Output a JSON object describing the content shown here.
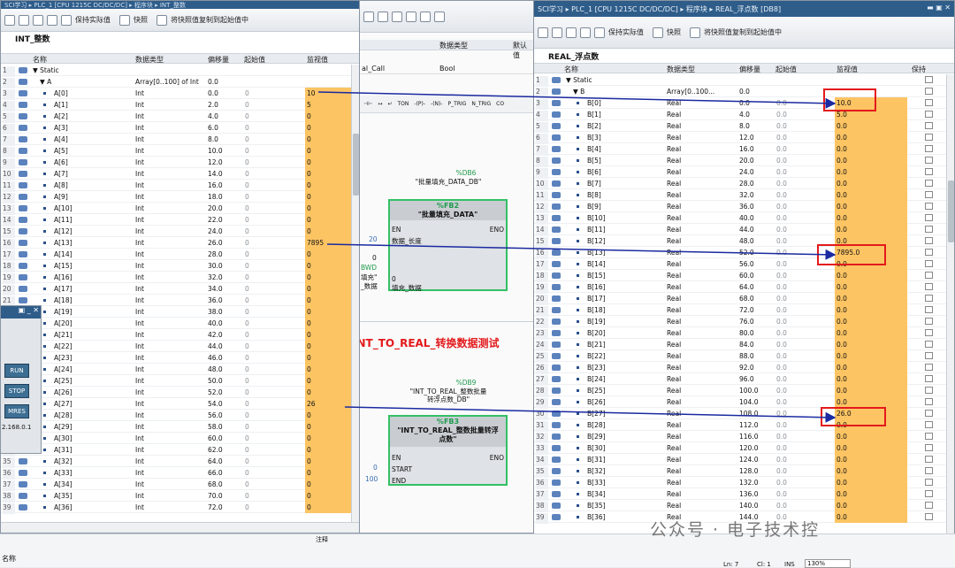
{
  "left_window": {
    "title": "SCI学习 ▸ PLC_1 [CPU 1215C DC/DC/DC] ▸ 程序块 ▸ INT_整数",
    "toolbar_labels": [
      "保持实际值",
      "快照",
      "将快照值复制到起始值中"
    ],
    "db_title": "INT_整数",
    "headers": [
      "名称",
      "数据类型",
      "偏移量",
      "起始值",
      "监视值"
    ],
    "rows": [
      {
        "n": "1",
        "name": "▼ Static",
        "type": "",
        "off": "",
        "start": "",
        "mon": ""
      },
      {
        "n": "2",
        "name": "▼ A",
        "type": "Array[0..100] of Int",
        "off": "0.0",
        "start": "",
        "mon": ""
      },
      {
        "n": "3",
        "name": "A[0]",
        "type": "Int",
        "off": "0.0",
        "start": "0",
        "mon": "10"
      },
      {
        "n": "4",
        "name": "A[1]",
        "type": "Int",
        "off": "2.0",
        "start": "0",
        "mon": "5"
      },
      {
        "n": "5",
        "name": "A[2]",
        "type": "Int",
        "off": "4.0",
        "start": "0",
        "mon": "0"
      },
      {
        "n": "6",
        "name": "A[3]",
        "type": "Int",
        "off": "6.0",
        "start": "0",
        "mon": "0"
      },
      {
        "n": "7",
        "name": "A[4]",
        "type": "Int",
        "off": "8.0",
        "start": "0",
        "mon": "0"
      },
      {
        "n": "8",
        "name": "A[5]",
        "type": "Int",
        "off": "10.0",
        "start": "0",
        "mon": "0"
      },
      {
        "n": "9",
        "name": "A[6]",
        "type": "Int",
        "off": "12.0",
        "start": "0",
        "mon": "0"
      },
      {
        "n": "10",
        "name": "A[7]",
        "type": "Int",
        "off": "14.0",
        "start": "0",
        "mon": "0"
      },
      {
        "n": "11",
        "name": "A[8]",
        "type": "Int",
        "off": "16.0",
        "start": "0",
        "mon": "0"
      },
      {
        "n": "12",
        "name": "A[9]",
        "type": "Int",
        "off": "18.0",
        "start": "0",
        "mon": "0"
      },
      {
        "n": "13",
        "name": "A[10]",
        "type": "Int",
        "off": "20.0",
        "start": "0",
        "mon": "0"
      },
      {
        "n": "14",
        "name": "A[11]",
        "type": "Int",
        "off": "22.0",
        "start": "0",
        "mon": "0"
      },
      {
        "n": "15",
        "name": "A[12]",
        "type": "Int",
        "off": "24.0",
        "start": "0",
        "mon": "0"
      },
      {
        "n": "16",
        "name": "A[13]",
        "type": "Int",
        "off": "26.0",
        "start": "0",
        "mon": "7895"
      },
      {
        "n": "17",
        "name": "A[14]",
        "type": "Int",
        "off": "28.0",
        "start": "0",
        "mon": "0"
      },
      {
        "n": "18",
        "name": "A[15]",
        "type": "Int",
        "off": "30.0",
        "start": "0",
        "mon": "0"
      },
      {
        "n": "19",
        "name": "A[16]",
        "type": "Int",
        "off": "32.0",
        "start": "0",
        "mon": "0"
      },
      {
        "n": "20",
        "name": "A[17]",
        "type": "Int",
        "off": "34.0",
        "start": "0",
        "mon": "0"
      },
      {
        "n": "21",
        "name": "A[18]",
        "type": "Int",
        "off": "36.0",
        "start": "0",
        "mon": "0"
      },
      {
        "n": "22",
        "name": "A[19]",
        "type": "Int",
        "off": "38.0",
        "start": "0",
        "mon": "0"
      },
      {
        "n": "23",
        "name": "A[20]",
        "type": "Int",
        "off": "40.0",
        "start": "0",
        "mon": "0"
      },
      {
        "n": "24",
        "name": "A[21]",
        "type": "Int",
        "off": "42.0",
        "start": "0",
        "mon": "0"
      },
      {
        "n": "25",
        "name": "A[22]",
        "type": "Int",
        "off": "44.0",
        "start": "0",
        "mon": "0"
      },
      {
        "n": "26",
        "name": "A[23]",
        "type": "Int",
        "off": "46.0",
        "start": "0",
        "mon": "0"
      },
      {
        "n": "27",
        "name": "A[24]",
        "type": "Int",
        "off": "48.0",
        "start": "0",
        "mon": "0"
      },
      {
        "n": "28",
        "name": "A[25]",
        "type": "Int",
        "off": "50.0",
        "start": "0",
        "mon": "0"
      },
      {
        "n": "29",
        "name": "A[26]",
        "type": "Int",
        "off": "52.0",
        "start": "0",
        "mon": "0"
      },
      {
        "n": "30",
        "name": "A[27]",
        "type": "Int",
        "off": "54.0",
        "start": "0",
        "mon": "26"
      },
      {
        "n": "31",
        "name": "A[28]",
        "type": "Int",
        "off": "56.0",
        "start": "0",
        "mon": "0"
      },
      {
        "n": "32",
        "name": "A[29]",
        "type": "Int",
        "off": "58.0",
        "start": "0",
        "mon": "0"
      },
      {
        "n": "33",
        "name": "A[30]",
        "type": "Int",
        "off": "60.0",
        "start": "0",
        "mon": "0"
      },
      {
        "n": "34",
        "name": "A[31]",
        "type": "Int",
        "off": "62.0",
        "start": "0",
        "mon": "0"
      },
      {
        "n": "35",
        "name": "A[32]",
        "type": "Int",
        "off": "64.0",
        "start": "0",
        "mon": "0"
      },
      {
        "n": "36",
        "name": "A[33]",
        "type": "Int",
        "off": "66.0",
        "start": "0",
        "mon": "0"
      },
      {
        "n": "37",
        "name": "A[34]",
        "type": "Int",
        "off": "68.0",
        "start": "0",
        "mon": "0"
      },
      {
        "n": "38",
        "name": "A[35]",
        "type": "Int",
        "off": "70.0",
        "start": "0",
        "mon": "0"
      },
      {
        "n": "39",
        "name": "A[36]",
        "type": "Int",
        "off": "72.0",
        "start": "0",
        "mon": "0"
      }
    ]
  },
  "right_window": {
    "title": "SCI学习 ▸ PLC_1 [CPU 1215C DC/DC/DC] ▸ 程序块 ▸ REAL_浮点数 [DB8]",
    "db_title": "REAL_浮点数",
    "headers": [
      "名称",
      "数据类型",
      "偏移量",
      "起始值",
      "监视值",
      "保持"
    ],
    "rows": [
      {
        "n": "1",
        "name": "▼ Static",
        "type": "",
        "off": "",
        "start": "",
        "mon": ""
      },
      {
        "n": "2",
        "name": "▼ B",
        "type": "Array[0..100...",
        "off": "0.0",
        "start": "",
        "mon": ""
      },
      {
        "n": "3",
        "name": "B[0]",
        "type": "Real",
        "off": "0.0",
        "start": "0.0",
        "mon": "10.0"
      },
      {
        "n": "4",
        "name": "B[1]",
        "type": "Real",
        "off": "4.0",
        "start": "0.0",
        "mon": "5.0"
      },
      {
        "n": "5",
        "name": "B[2]",
        "type": "Real",
        "off": "8.0",
        "start": "0.0",
        "mon": "0.0"
      },
      {
        "n": "6",
        "name": "B[3]",
        "type": "Real",
        "off": "12.0",
        "start": "0.0",
        "mon": "0.0"
      },
      {
        "n": "7",
        "name": "B[4]",
        "type": "Real",
        "off": "16.0",
        "start": "0.0",
        "mon": "0.0"
      },
      {
        "n": "8",
        "name": "B[5]",
        "type": "Real",
        "off": "20.0",
        "start": "0.0",
        "mon": "0.0"
      },
      {
        "n": "9",
        "name": "B[6]",
        "type": "Real",
        "off": "24.0",
        "start": "0.0",
        "mon": "0.0"
      },
      {
        "n": "10",
        "name": "B[7]",
        "type": "Real",
        "off": "28.0",
        "start": "0.0",
        "mon": "0.0"
      },
      {
        "n": "11",
        "name": "B[8]",
        "type": "Real",
        "off": "32.0",
        "start": "0.0",
        "mon": "0.0"
      },
      {
        "n": "12",
        "name": "B[9]",
        "type": "Real",
        "off": "36.0",
        "start": "0.0",
        "mon": "0.0"
      },
      {
        "n": "13",
        "name": "B[10]",
        "type": "Real",
        "off": "40.0",
        "start": "0.0",
        "mon": "0.0"
      },
      {
        "n": "14",
        "name": "B[11]",
        "type": "Real",
        "off": "44.0",
        "start": "0.0",
        "mon": "0.0"
      },
      {
        "n": "15",
        "name": "B[12]",
        "type": "Real",
        "off": "48.0",
        "start": "0.0",
        "mon": "0.0"
      },
      {
        "n": "16",
        "name": "B[13]",
        "type": "Real",
        "off": "52.0",
        "start": "0.0",
        "mon": "7895.0"
      },
      {
        "n": "17",
        "name": "B[14]",
        "type": "Real",
        "off": "56.0",
        "start": "0.0",
        "mon": "0.0"
      },
      {
        "n": "18",
        "name": "B[15]",
        "type": "Real",
        "off": "60.0",
        "start": "0.0",
        "mon": "0.0"
      },
      {
        "n": "19",
        "name": "B[16]",
        "type": "Real",
        "off": "64.0",
        "start": "0.0",
        "mon": "0.0"
      },
      {
        "n": "20",
        "name": "B[17]",
        "type": "Real",
        "off": "68.0",
        "start": "0.0",
        "mon": "0.0"
      },
      {
        "n": "21",
        "name": "B[18]",
        "type": "Real",
        "off": "72.0",
        "start": "0.0",
        "mon": "0.0"
      },
      {
        "n": "22",
        "name": "B[19]",
        "type": "Real",
        "off": "76.0",
        "start": "0.0",
        "mon": "0.0"
      },
      {
        "n": "23",
        "name": "B[20]",
        "type": "Real",
        "off": "80.0",
        "start": "0.0",
        "mon": "0.0"
      },
      {
        "n": "24",
        "name": "B[21]",
        "type": "Real",
        "off": "84.0",
        "start": "0.0",
        "mon": "0.0"
      },
      {
        "n": "25",
        "name": "B[22]",
        "type": "Real",
        "off": "88.0",
        "start": "0.0",
        "mon": "0.0"
      },
      {
        "n": "26",
        "name": "B[23]",
        "type": "Real",
        "off": "92.0",
        "start": "0.0",
        "mon": "0.0"
      },
      {
        "n": "27",
        "name": "B[24]",
        "type": "Real",
        "off": "96.0",
        "start": "0.0",
        "mon": "0.0"
      },
      {
        "n": "28",
        "name": "B[25]",
        "type": "Real",
        "off": "100.0",
        "start": "0.0",
        "mon": "0.0"
      },
      {
        "n": "29",
        "name": "B[26]",
        "type": "Real",
        "off": "104.0",
        "start": "0.0",
        "mon": "0.0"
      },
      {
        "n": "30",
        "name": "B[27]",
        "type": "Real",
        "off": "108.0",
        "start": "0.0",
        "mon": "26.0"
      },
      {
        "n": "31",
        "name": "B[28]",
        "type": "Real",
        "off": "112.0",
        "start": "0.0",
        "mon": "0.0"
      },
      {
        "n": "32",
        "name": "B[29]",
        "type": "Real",
        "off": "116.0",
        "start": "0.0",
        "mon": "0.0"
      },
      {
        "n": "33",
        "name": "B[30]",
        "type": "Real",
        "off": "120.0",
        "start": "0.0",
        "mon": "0.0"
      },
      {
        "n": "34",
        "name": "B[31]",
        "type": "Real",
        "off": "124.0",
        "start": "0.0",
        "mon": "0.0"
      },
      {
        "n": "35",
        "name": "B[32]",
        "type": "Real",
        "off": "128.0",
        "start": "0.0",
        "mon": "0.0"
      },
      {
        "n": "36",
        "name": "B[33]",
        "type": "Real",
        "off": "132.0",
        "start": "0.0",
        "mon": "0.0"
      },
      {
        "n": "37",
        "name": "B[34]",
        "type": "Real",
        "off": "136.0",
        "start": "0.0",
        "mon": "0.0"
      },
      {
        "n": "38",
        "name": "B[35]",
        "type": "Real",
        "off": "140.0",
        "start": "0.0",
        "mon": "0.0"
      },
      {
        "n": "39",
        "name": "B[36]",
        "type": "Real",
        "off": "144.0",
        "start": "0.0",
        "mon": "0.0"
      }
    ]
  },
  "middle": {
    "iface_headers": [
      "数据类型",
      "默认值"
    ],
    "iface_row": {
      "name": "al_Call",
      "type": "Bool"
    },
    "instr_labels": [
      "TON",
      "-(P)-",
      "-(N)-",
      "P_TRIG",
      "N_TRIG",
      "CO"
    ],
    "block1": {
      "db": "%DB6",
      "db_name": "\"批量填充_DATA_DB\"",
      "fb": "%FB2",
      "title": "\"批量填充_DATA\"",
      "en": "EN",
      "eno": "ENO",
      "in1_val": "20",
      "in1": "数据_长度",
      "in2_val": "0",
      "in2": "填充_数据",
      "side1": "0",
      "side2": "BWD",
      "side3": "填充\"",
      "side4": "_数据"
    },
    "heading": "INT_TO_REAL_转换数据测试",
    "block2": {
      "db": "%DB9",
      "db_name": "\"INT_TO_REAL_整数批量转浮点数_DB\"",
      "fb": "%FB3",
      "title": "\"INT_TO_REAL_整数批量转浮点数\"",
      "en": "EN",
      "eno": "ENO",
      "start_val": "0",
      "start": "START",
      "end_val": "100",
      "end": "END"
    }
  },
  "online_panel": {
    "title": "▣ _ ✕",
    "buttons": [
      "RUN",
      "STOP",
      "MRES"
    ],
    "ip": "2.168.0.1"
  },
  "bottom": {
    "left_label": "名称",
    "note": "注释",
    "ln": "Ln: 7",
    "cl": "Cl: 1",
    "ins": "INS",
    "zoom": "130%"
  },
  "watermark": "公众号 · 电子技术控",
  "colors": {
    "monitor_bg": "#fcc463",
    "arrow": "#1a2aa0",
    "highlight": "#e31a1c",
    "block_border": "#33c065",
    "title_bar": "#2f5d8a"
  }
}
